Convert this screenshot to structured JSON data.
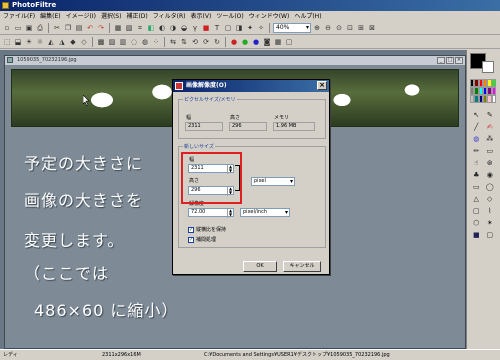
{
  "app": {
    "title": "PhotoFiltre"
  },
  "menu": [
    "ファイル(F)",
    "編集(E)",
    "イメージ(I)",
    "選択(S)",
    "補正(D)",
    "フィルタ(R)",
    "表示(V)",
    "ツール(O)",
    "ウィンドウ(W)",
    "ヘルプ(H)"
  ],
  "toolbar": {
    "zoom_value": "40%"
  },
  "document": {
    "title": "1059035_70232196.jpg"
  },
  "caption": {
    "line1": "予定の大きさに",
    "line2": "画像の大きさを",
    "line3": "変更します。",
    "line4": "（ここでは",
    "line5": "486×60 に縮小）"
  },
  "dialog": {
    "title": "画像解像度(O)",
    "pixel_group": "ピクセルサイズ/メモリ",
    "width_label": "幅",
    "height_label": "高さ",
    "memory_label": "メモリ",
    "current_width": "2311",
    "current_height": "296",
    "current_memory": "1.96 MB",
    "new_group": "新しいサイズ",
    "new_width_label": "幅",
    "new_width": "2311",
    "new_height_label": "高さ",
    "new_height": "296",
    "unit_value": "pixel",
    "resolution_label": "解像度",
    "resolution_value": "72.00",
    "res_unit_value": "pixel/inch",
    "keep_ratio_label": "縦横比を保持",
    "interp_label": "補間処理",
    "ok_label": "OK",
    "cancel_label": "キャンセル"
  },
  "status": {
    "ready": "レディ",
    "size": "2311x296x16M",
    "path": "C:¥Documents and Settings¥USER1¥デスクトップ¥1059035_70232196.jpg"
  },
  "colors": {
    "title_bar": "#0a246a",
    "highlight_box": "#e02020",
    "workspace": "#6a7886"
  }
}
